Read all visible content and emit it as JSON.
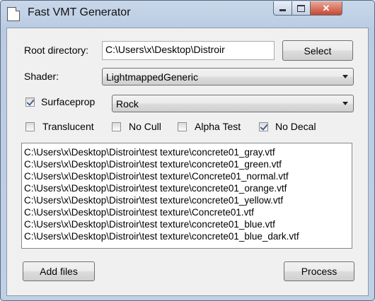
{
  "window": {
    "title": "Fast VMT Generator"
  },
  "root_directory": {
    "label": "Root directory:",
    "value": "C:\\Users\\x\\Desktop\\Distroir",
    "select_label": "Select"
  },
  "shader": {
    "label": "Shader:",
    "value": "LightmappedGeneric"
  },
  "surfaceprop": {
    "label": "Surfaceprop",
    "checked": true,
    "value": "Rock"
  },
  "options": [
    {
      "label": "Translucent",
      "checked": false
    },
    {
      "label": "No Cull",
      "checked": false
    },
    {
      "label": "Alpha Test",
      "checked": false
    },
    {
      "label": "No Decal",
      "checked": true
    }
  ],
  "files": [
    "C:\\Users\\x\\Desktop\\Distroir\\test texture\\concrete01_gray.vtf",
    "C:\\Users\\x\\Desktop\\Distroir\\test texture\\concrete01_green.vtf",
    "C:\\Users\\x\\Desktop\\Distroir\\test texture\\Concrete01_normal.vtf",
    "C:\\Users\\x\\Desktop\\Distroir\\test texture\\concrete01_orange.vtf",
    "C:\\Users\\x\\Desktop\\Distroir\\test texture\\concrete01_yellow.vtf",
    "C:\\Users\\x\\Desktop\\Distroir\\test texture\\Concrete01.vtf",
    "C:\\Users\\x\\Desktop\\Distroir\\test texture\\concrete01_blue.vtf",
    "C:\\Users\\x\\Desktop\\Distroir\\test texture\\concrete01_blue_dark.vtf"
  ],
  "buttons": {
    "add_files": "Add files",
    "process": "Process"
  }
}
